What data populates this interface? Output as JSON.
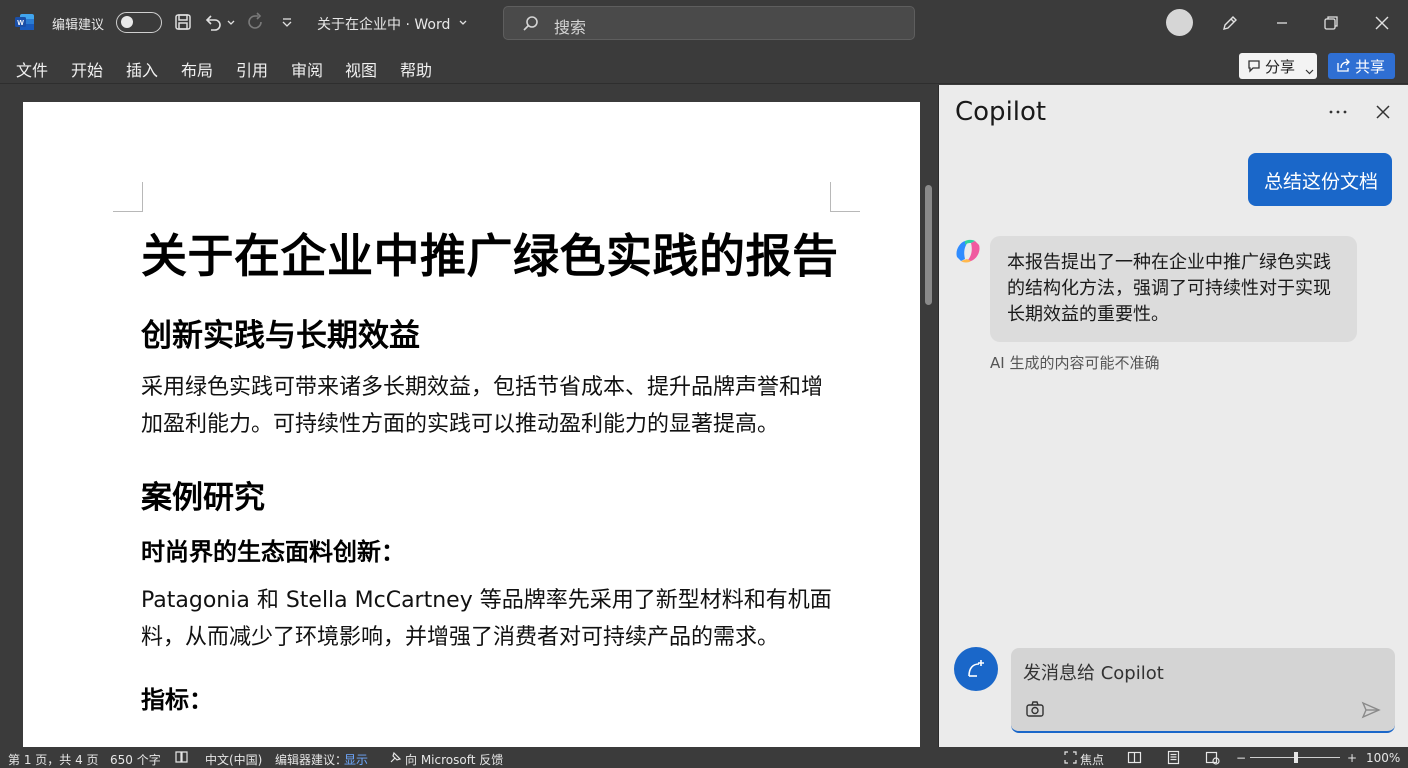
{
  "titlebar": {
    "edit_suggestions": "编辑建议",
    "doc_title": "关于在企业中 · Word",
    "search_placeholder": "搜索"
  },
  "menu": {
    "items": [
      "文件",
      "开始",
      "插入",
      "布局",
      "引用",
      "审阅",
      "视图",
      "帮助"
    ],
    "share_outline": "分享",
    "share": "共享"
  },
  "document": {
    "title": "关于在企业中推广绿色实践的报告",
    "section1_heading": "创新实践与长期效益",
    "section1_body": "采用绿色实践可带来诸多长期效益，包括节省成本、提升品牌声誉和增加盈利能力。可持续性方面的实践可以推动盈利能力的显著提高。",
    "section2_heading": "案例研究",
    "section2_sub": "时尚界的生态面料创新：",
    "section2_body": "Patagonia 和 Stella McCartney 等品牌率先采用了新型材料和有机面料，从而减少了环境影响，并增强了消费者对可持续产品的需求。",
    "section3_sub": "指标："
  },
  "copilot": {
    "title": "Copilot",
    "user_message": "总结这份文档",
    "ai_message": "本报告提出了一种在企业中推广绿色实践的结构化方法，强调了可持续性对于实现长期效益的重要性。",
    "ai_disclaimer": "AI 生成的内容可能不准确",
    "input_placeholder": "发消息给 Copilot",
    "accent_color": "#1a67c9"
  },
  "status": {
    "page": "第 1 页，共 4 页",
    "words": "650 个字",
    "language": "中文(中国)",
    "edit_suggestions_label": "编辑器建议：",
    "edit_suggestions_value": "显示",
    "feedback": "向 Microsoft 反馈",
    "focus": "焦点",
    "zoom": "100%"
  }
}
